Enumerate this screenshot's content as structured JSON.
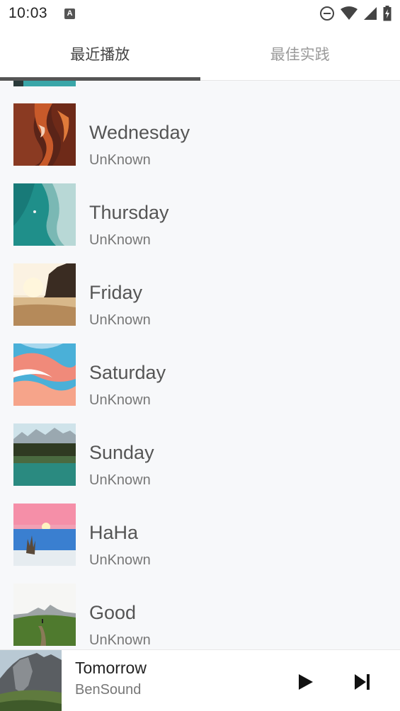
{
  "status_bar": {
    "time": "10:03",
    "notification_letter": "A"
  },
  "tabs": [
    {
      "label": "最近播放",
      "active": true
    },
    {
      "label": "最佳实践",
      "active": false
    }
  ],
  "songs": [
    {
      "title": "Wednesday",
      "artist": "UnKnown",
      "thumb": "canyon"
    },
    {
      "title": "Thursday",
      "artist": "UnKnown",
      "thumb": "ocean-aerial"
    },
    {
      "title": "Friday",
      "artist": "UnKnown",
      "thumb": "sunset-beach"
    },
    {
      "title": "Saturday",
      "artist": "UnKnown",
      "thumb": "paint-swirl"
    },
    {
      "title": "Sunday",
      "artist": "UnKnown",
      "thumb": "mountain-lake"
    },
    {
      "title": "HaHa",
      "artist": "UnKnown",
      "thumb": "pink-sky-sea"
    },
    {
      "title": "Good",
      "artist": "UnKnown",
      "thumb": "green-hills"
    }
  ],
  "now_playing": {
    "title": "Tomorrow",
    "artist": "BenSound"
  },
  "colors": {
    "tab_indicator": "#555555",
    "background": "#f7f8fa"
  }
}
